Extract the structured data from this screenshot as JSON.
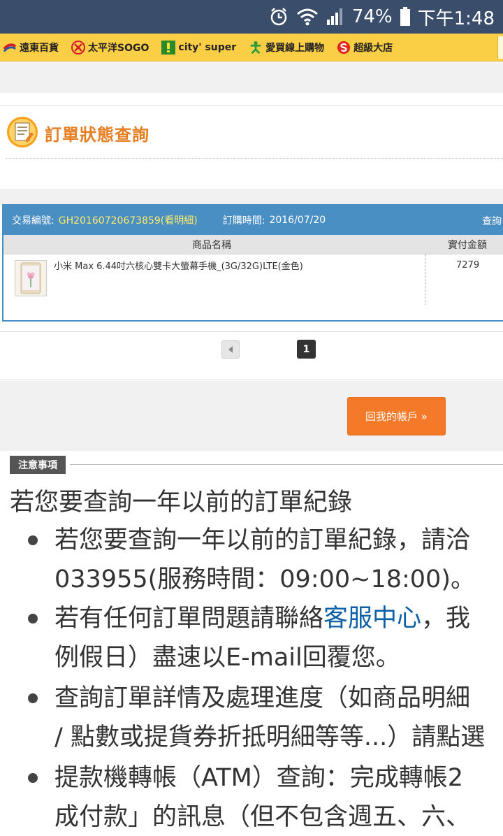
{
  "status_bar": {
    "battery": "74%",
    "time": "下午1:48"
  },
  "stores": [
    {
      "icon": "fareastern-logo-icon",
      "label": "遠東百貨",
      "color": "#1e5aa8"
    },
    {
      "icon": "sogo-logo-icon",
      "label": "太平洋SOGO",
      "color": "#d61d2a"
    },
    {
      "icon": "citysuper-logo-icon",
      "label": "city' super",
      "color": "#2a8a2a"
    },
    {
      "icon": "shopping-logo-icon",
      "label": "愛買線上購物",
      "color": "#2b9a3a"
    },
    {
      "icon": "sogo-s-logo-icon",
      "label": "超級大店",
      "color": "#e0261f"
    }
  ],
  "page": {
    "title": "訂單狀態查詢"
  },
  "order": {
    "id_label": "交易編號:",
    "id": "GH20160720673859(看明細)",
    "time_label": "訂購時間:",
    "time": "2016/07/20",
    "query_link": "查詢",
    "col_name": "商品名稱",
    "col_amount": "實付金額",
    "items": [
      {
        "name": "小米 Max 6.44吋六核心雙卡大螢幕手機_(3G/32G)LTE(金色)",
        "amount": "7279"
      }
    ]
  },
  "pagination": {
    "current": "1"
  },
  "back_button": "回我的帳戶 »",
  "notice": {
    "tag": "注意事項",
    "heading": "若您要查詢一年以前的訂單紀錄",
    "bullets": [
      {
        "l1": "若您要查詢一年以前的訂單紀錄，請洽",
        "l2": "033955(服務時間：09:00~18:00)。"
      },
      {
        "l1_a": "若有任何訂單問題請聯絡",
        "l1_link": "客服中心",
        "l1_b": "，我",
        "l2": "例假日）盡速以E-mail回覆您。"
      },
      {
        "l1": "查詢訂單詳情及處理進度（如商品明細",
        "l2": "/ 點數或提貨券折抵明細等等...）請點選"
      },
      {
        "l1": "提款機轉帳（ATM）查詢：完成轉帳2",
        "l2": "成付款」的訊息（但不包含週五、六、"
      }
    ]
  }
}
